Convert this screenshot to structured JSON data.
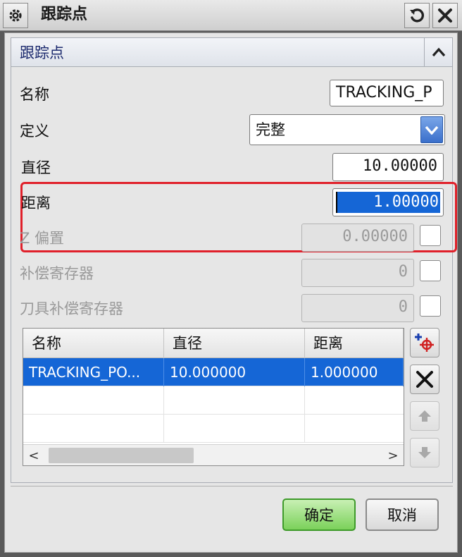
{
  "window": {
    "title": "跟踪点",
    "icons": {
      "settings": "gear-icon",
      "reset": "reset-icon",
      "close": "close-icon"
    }
  },
  "group": {
    "title": "跟踪点",
    "collapse_icon": "chevron-up-icon"
  },
  "form": {
    "name_label": "名称",
    "name_value": "TRACKING_P",
    "definition_label": "定义",
    "definition_value": "完整",
    "diameter_label": "直径",
    "diameter_value": "10.00000",
    "distance_label": "距离",
    "distance_value": "1.00000",
    "z_offset_label": "Z 偏置",
    "z_offset_value": "0.00000",
    "comp_register_label": "补偿寄存器",
    "comp_register_value": "0",
    "tool_comp_register_label": "刀具补偿寄存器",
    "tool_comp_register_value": "0"
  },
  "list": {
    "columns": [
      "名称",
      "直径",
      "距离"
    ],
    "rows": [
      {
        "name": "TRACKING_PO...",
        "diameter": "10.000000",
        "distance": "1.000000"
      }
    ],
    "scroll_left": "<",
    "scroll_right": ">"
  },
  "side_buttons": [
    "add-point-icon",
    "delete-icon",
    "move-up-icon",
    "move-down-icon"
  ],
  "buttons": {
    "ok": "确定",
    "cancel": "取消"
  },
  "colors": {
    "highlight_box": "#e0202a",
    "selection": "#1566d6",
    "ok_button": "#7bd15a"
  }
}
